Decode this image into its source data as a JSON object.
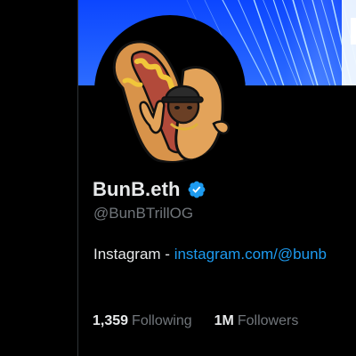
{
  "colors": {
    "background": "#000000",
    "banner_blue": "#1d5bff",
    "text_primary": "#e7e9ea",
    "text_secondary": "#71767b",
    "link_blue": "#1d9bf0",
    "verified_blue": "#1d9bf0"
  },
  "profile": {
    "display_name": "BunB.eth",
    "verified": true,
    "verified_icon": "verified-badge-icon",
    "handle": "@BunBTrillOG",
    "bio_prefix": "Instagram - ",
    "bio_link": "instagram.com/@bunb",
    "avatar_icon": "hotdog-character-avatar"
  },
  "stats": {
    "following_count": "1,359",
    "following_label": "Following",
    "followers_count": "1M",
    "followers_label": "Followers"
  }
}
